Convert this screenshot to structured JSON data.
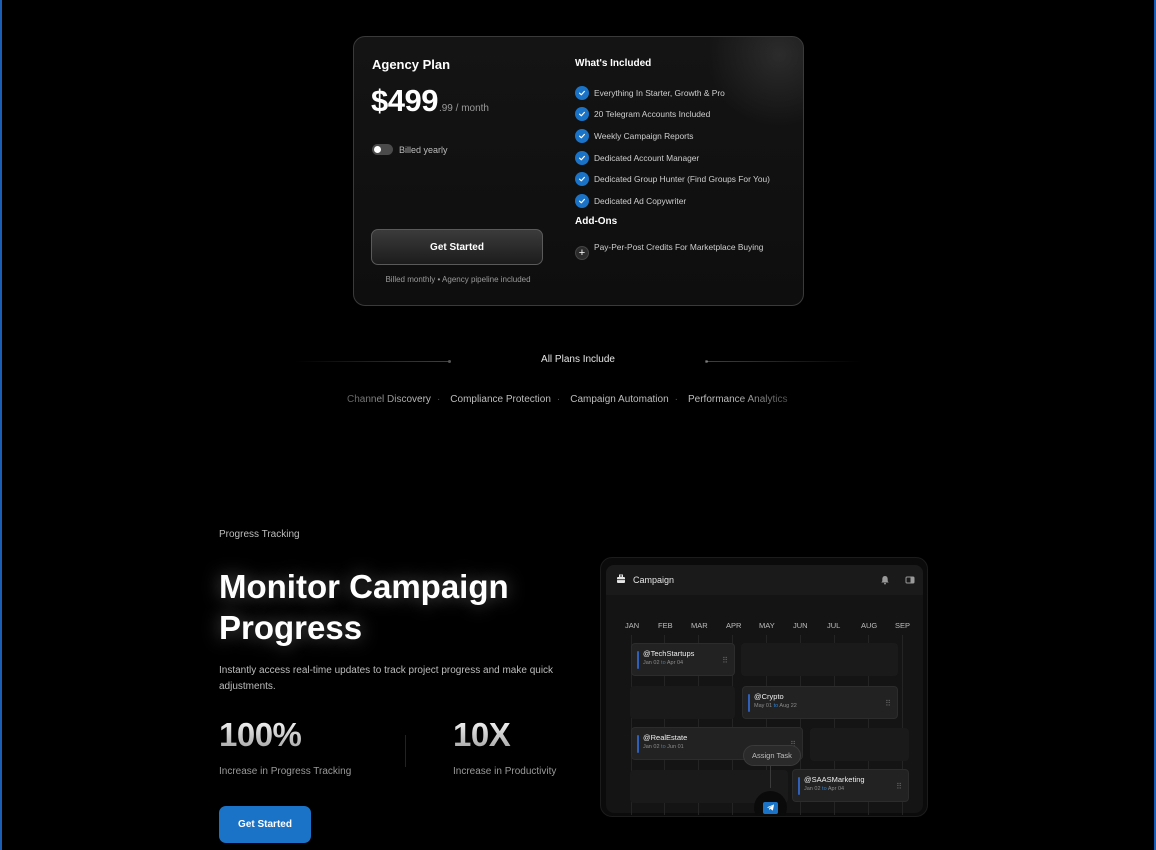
{
  "pricing_card": {
    "plan_name": "Agency Plan",
    "price_main": "$499",
    "price_suffix": ".99 / month",
    "toggle_label": "Billed yearly",
    "toggle_on": false,
    "cta_label": "Get Started",
    "note": "Billed monthly • Agency pipeline included",
    "included_title": "What's Included",
    "features": [
      "Everything In Starter, Growth & Pro",
      "20 Telegram Accounts Included",
      "Weekly Campaign Reports",
      "Dedicated Account Manager",
      "Dedicated Group Hunter (Find Groups For You)",
      "Dedicated Ad Copywriter"
    ],
    "addons_title": "Add-Ons",
    "addon": "Pay-Per-Post Credits For Marketplace Buying"
  },
  "all_plans": {
    "title": "All Plans Include",
    "items": [
      "Channel Discovery",
      "Compliance Protection",
      "Campaign Automation",
      "Performance Analytics"
    ]
  },
  "progress": {
    "eyebrow": "Progress Tracking",
    "headline": "Monitor Campaign Progress",
    "description": "Instantly access real-time updates to track project progress and make quick adjustments.",
    "stats": [
      {
        "value": "100%",
        "label": "Increase in Progress Tracking"
      },
      {
        "value": "10X",
        "label": "Increase in Productivity"
      }
    ],
    "cta_label": "Get Started"
  },
  "campaign_widget": {
    "title": "Campaign",
    "icons": [
      "briefcase-icon",
      "bell-icon",
      "panel-icon"
    ],
    "months": [
      "JAN",
      "FEB",
      "MAR",
      "APR",
      "MAY",
      "JUN",
      "JUL",
      "AUG",
      "SEP"
    ],
    "tasks": [
      {
        "name": "@TechStartups",
        "start": "Jan 02",
        "to": "to",
        "end": "Apr 04"
      },
      {
        "name": "@Crypto",
        "start": "May 01",
        "to": "to",
        "end": "Aug 22"
      },
      {
        "name": "@RealEstate",
        "start": "Jan 02",
        "to": "to",
        "end": "Jun 01"
      },
      {
        "name": "@SAASMarketing",
        "start": "Jan 02",
        "to": "to",
        "end": "Apr 04"
      }
    ],
    "assign_label": "Assign Task"
  },
  "colors": {
    "accent": "#1a73c7",
    "background": "#000000",
    "card_border": "#3a3a3a"
  }
}
